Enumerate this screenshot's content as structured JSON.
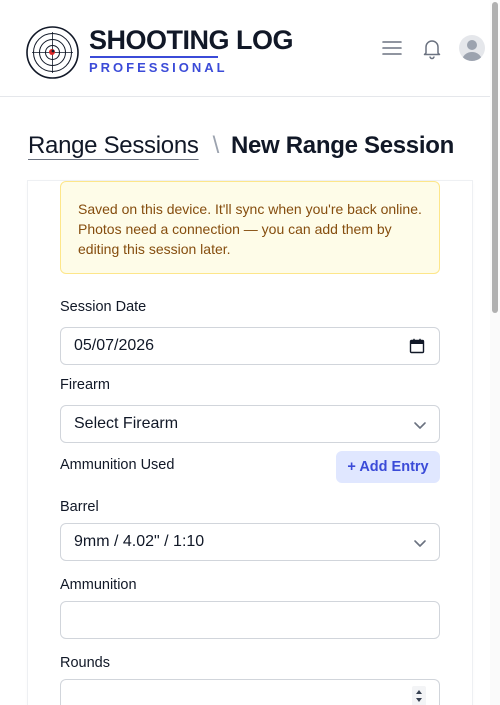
{
  "header": {
    "brand_title": "SHOOTING LOG",
    "brand_subtitle": "PROFESSIONAL",
    "icons": [
      "target-logo-icon",
      "menu-icon",
      "bell-icon",
      "avatar-icon"
    ]
  },
  "breadcrumb": {
    "parent": "Range Sessions",
    "separator": "\\",
    "current": "New Range Session"
  },
  "alert": {
    "message": "Saved on this device. It'll sync when you're back online. Photos need a connection — you can add them by editing this session later."
  },
  "form": {
    "session_date_label": "Session Date",
    "session_date_value": "05/07/2026",
    "firearm_label": "Firearm",
    "firearm_value": "Select Firearm",
    "ammunition_used_label": "Ammunition Used",
    "add_entry_label": "+ Add Entry",
    "barrel_label": "Barrel",
    "barrel_value": "9mm / 4.02\" / 1:10",
    "ammunition_label": "Ammunition",
    "ammunition_value": "",
    "rounds_label": "Rounds",
    "rounds_value": ""
  },
  "colors": {
    "accent": "#3b4bd8",
    "alert_bg": "#fefce8",
    "alert_text": "#854d0e",
    "alert_border": "#fde68a"
  }
}
